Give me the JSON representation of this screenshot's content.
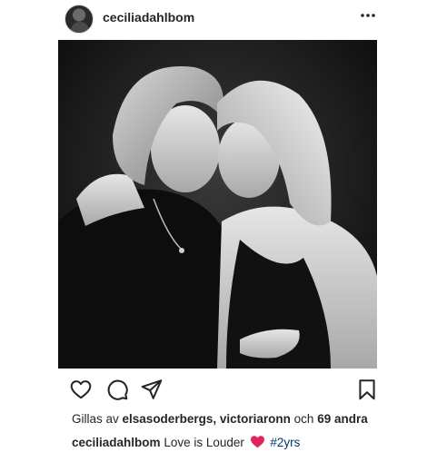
{
  "post": {
    "username": "ceciliadahlbom",
    "more_icon": "more-horizontal-icon",
    "photo_description_icon": "photo"
  },
  "actions": {
    "like_icon": "heart-outline-icon",
    "comment_icon": "comment-icon",
    "share_icon": "paper-plane-icon",
    "save_icon": "bookmark-icon"
  },
  "likes": {
    "prefix": "Gillas av",
    "user1": "elsasoderbergs,",
    "user2": "victoriaronn",
    "middle": "och",
    "others": "69 andra"
  },
  "caption": {
    "username": "ceciliadahlbom",
    "text": "Love is Louder",
    "emoji": "red-heart",
    "hashtag": "#2yrs"
  },
  "colors": {
    "text": "#262626",
    "hashtag": "#00376b",
    "heart": "#e0245e"
  }
}
